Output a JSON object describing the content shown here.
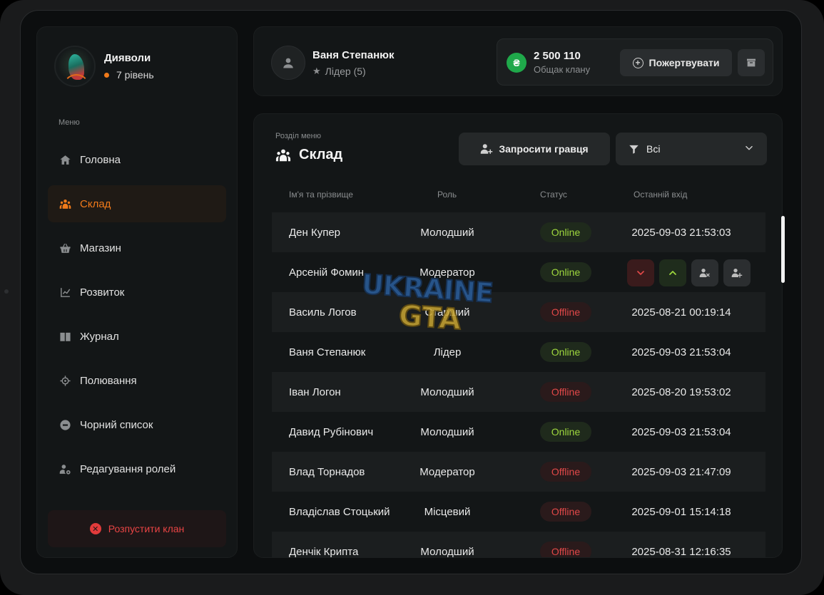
{
  "clan": {
    "name": "Дияволи",
    "level": "7 рівень"
  },
  "menu": {
    "caption": "Меню",
    "items": [
      {
        "label": "Головна",
        "icon": "home-icon"
      },
      {
        "label": "Склад",
        "icon": "people-icon",
        "active": true
      },
      {
        "label": "Магазин",
        "icon": "basket-icon"
      },
      {
        "label": "Розвиток",
        "icon": "chart-icon"
      },
      {
        "label": "Журнал",
        "icon": "book-icon"
      },
      {
        "label": "Полювання",
        "icon": "crosshair-icon"
      },
      {
        "label": "Чорний список",
        "icon": "block-icon"
      },
      {
        "label": "Редагування ролей",
        "icon": "user-gear-icon"
      }
    ],
    "disband_label": "Розпустити клан"
  },
  "user": {
    "name": "Ваня Степанюк",
    "role": "Лідер (5)"
  },
  "balance": {
    "currency_symbol": "₴",
    "amount": "2 500 110",
    "label": "Общак клану",
    "donate_label": "Пожертвувати"
  },
  "section": {
    "caption": "Розділ меню",
    "title": "Склад",
    "invite_label": "Запросити гравця",
    "filter_value": "Всі"
  },
  "table": {
    "headers": {
      "name": "Ім'я та прізвище",
      "role": "Роль",
      "status": "Статус",
      "last": "Останній вхід"
    },
    "rows": [
      {
        "name": "Ден Купер",
        "role": "Молодший",
        "status": "Online",
        "last": "2025-09-03 21:53:03"
      },
      {
        "name": "Арсеній Фомин",
        "role": "Модератор",
        "status": "Online",
        "last": ""
      },
      {
        "name": "Василь Логов",
        "role": "Старший",
        "status": "Offline",
        "last": "2025-08-21 00:19:14"
      },
      {
        "name": "Ваня Степанюк",
        "role": "Лідер",
        "status": "Online",
        "last": "2025-09-03 21:53:04"
      },
      {
        "name": "Іван Логон",
        "role": "Молодший",
        "status": "Offline",
        "last": "2025-08-20 19:53:02"
      },
      {
        "name": "Давид Рубінович",
        "role": "Молодший",
        "status": "Online",
        "last": "2025-09-03 21:53:04"
      },
      {
        "name": "Влад Торнадов",
        "role": "Модератор",
        "status": "Offline",
        "last": "2025-09-03 21:47:09"
      },
      {
        "name": "Владіслав Стоцький",
        "role": "Місцевий",
        "status": "Offline",
        "last": "2025-09-01 15:14:18"
      },
      {
        "name": "Денчік Крипта",
        "role": "Молодший",
        "status": "Offline",
        "last": "2025-08-31 12:16:35"
      }
    ]
  },
  "watermark": {
    "line1": "UKRAINE",
    "line2": "GTA"
  },
  "colors": {
    "accent": "#f07a1a",
    "online": "#9fd83e",
    "offline": "#e04848",
    "danger": "#e23b3b",
    "coin": "#1fa84a"
  }
}
